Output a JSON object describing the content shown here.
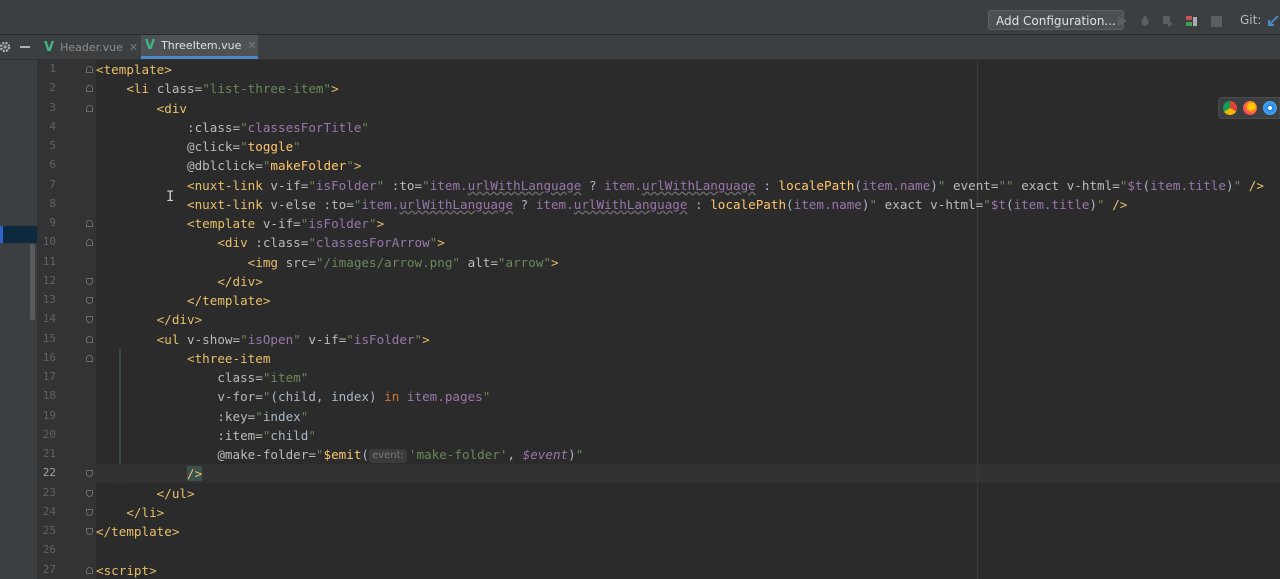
{
  "toolbar": {
    "add_configuration": "Add Configuration...",
    "git_label": "Git:"
  },
  "tabs": [
    {
      "label": "Header.vue",
      "active": false
    },
    {
      "label": "ThreeItem.vue",
      "active": true
    }
  ],
  "editor": {
    "current_line": 22,
    "line_numbers": [
      "1",
      "2",
      "3",
      "4",
      "5",
      "6",
      "7",
      "8",
      "9",
      "10",
      "11",
      "12",
      "13",
      "14",
      "15",
      "16",
      "17",
      "18",
      "19",
      "20",
      "21",
      "22",
      "23",
      "24",
      "25",
      "26",
      "27"
    ],
    "lines": [
      [
        [
          "t-tag",
          "<template>"
        ]
      ],
      [
        [
          "t-pun",
          "    "
        ],
        [
          "t-tag",
          "<li "
        ],
        [
          "t-attr",
          "class="
        ],
        [
          "t-str",
          "\"list-three-item\""
        ],
        [
          "t-tag",
          ">"
        ]
      ],
      [
        [
          "t-pun",
          "        "
        ],
        [
          "t-tag",
          "<div"
        ]
      ],
      [
        [
          "t-pun",
          "            "
        ],
        [
          "t-attr",
          ":class="
        ],
        [
          "t-str",
          "\""
        ],
        [
          "t-ident",
          "classesForTitle"
        ],
        [
          "t-str",
          "\""
        ]
      ],
      [
        [
          "t-pun",
          "            "
        ],
        [
          "t-attr",
          "@click="
        ],
        [
          "t-str",
          "\""
        ],
        [
          "t-fn",
          "toggle"
        ],
        [
          "t-str",
          "\""
        ]
      ],
      [
        [
          "t-pun",
          "            "
        ],
        [
          "t-attr",
          "@dblclick="
        ],
        [
          "t-str",
          "\""
        ],
        [
          "t-fn",
          "makeFolder"
        ],
        [
          "t-str",
          "\""
        ],
        [
          "t-tag",
          ">"
        ]
      ],
      [
        [
          "t-pun",
          "            "
        ],
        [
          "t-tag",
          "<nuxt-link "
        ],
        [
          "t-attr",
          "v-if="
        ],
        [
          "t-str",
          "\""
        ],
        [
          "t-ident",
          "isFolder"
        ],
        [
          "t-str",
          "\" "
        ],
        [
          "t-attr",
          ":to="
        ],
        [
          "t-str",
          "\""
        ],
        [
          "t-ident",
          "item."
        ],
        [
          "t-ident t-wavy",
          "urlWithLanguage"
        ],
        [
          "t-pun",
          " ? "
        ],
        [
          "t-ident",
          "item."
        ],
        [
          "t-ident t-wavy",
          "urlWithLanguage"
        ],
        [
          "t-pun",
          " : "
        ],
        [
          "t-fn",
          "localePath"
        ],
        [
          "t-pun",
          "("
        ],
        [
          "t-ident",
          "item.name"
        ],
        [
          "t-pun",
          ")"
        ],
        [
          "t-str",
          "\" "
        ],
        [
          "t-attr",
          "event="
        ],
        [
          "t-str",
          "\"\" "
        ],
        [
          "t-attr",
          "exact v-html="
        ],
        [
          "t-str",
          "\""
        ],
        [
          "t-ident",
          "$t"
        ],
        [
          "t-pun",
          "("
        ],
        [
          "t-ident",
          "item.title"
        ],
        [
          "t-pun",
          ")"
        ],
        [
          "t-str",
          "\" "
        ],
        [
          "t-tag",
          "/>"
        ]
      ],
      [
        [
          "t-pun",
          "            "
        ],
        [
          "t-tag",
          "<nuxt-link "
        ],
        [
          "t-attr",
          "v-else :to="
        ],
        [
          "t-str",
          "\""
        ],
        [
          "t-ident",
          "item."
        ],
        [
          "t-ident t-wavy",
          "urlWithLanguage"
        ],
        [
          "t-pun",
          " ? "
        ],
        [
          "t-ident",
          "item."
        ],
        [
          "t-ident t-wavy",
          "urlWithLanguage"
        ],
        [
          "t-pun",
          " : "
        ],
        [
          "t-fn",
          "localePath"
        ],
        [
          "t-pun",
          "("
        ],
        [
          "t-ident",
          "item.name"
        ],
        [
          "t-pun",
          ")"
        ],
        [
          "t-str",
          "\" "
        ],
        [
          "t-attr",
          "exact v-html="
        ],
        [
          "t-str",
          "\""
        ],
        [
          "t-ident",
          "$t"
        ],
        [
          "t-pun",
          "("
        ],
        [
          "t-ident",
          "item.title"
        ],
        [
          "t-pun",
          ")"
        ],
        [
          "t-str",
          "\" "
        ],
        [
          "t-tag",
          "/>"
        ]
      ],
      [
        [
          "t-pun",
          "            "
        ],
        [
          "t-tag",
          "<template "
        ],
        [
          "t-attr",
          "v-if="
        ],
        [
          "t-str",
          "\""
        ],
        [
          "t-ident",
          "isFolder"
        ],
        [
          "t-str",
          "\""
        ],
        [
          "t-tag",
          ">"
        ]
      ],
      [
        [
          "t-pun",
          "                "
        ],
        [
          "t-tag",
          "<div "
        ],
        [
          "t-attr",
          ":class="
        ],
        [
          "t-str",
          "\""
        ],
        [
          "t-ident",
          "classesForArrow"
        ],
        [
          "t-str",
          "\""
        ],
        [
          "t-tag",
          ">"
        ]
      ],
      [
        [
          "t-pun",
          "                    "
        ],
        [
          "t-tag",
          "<img "
        ],
        [
          "t-attr",
          "src="
        ],
        [
          "t-str",
          "\"/images/arrow.png\" "
        ],
        [
          "t-attr",
          "alt="
        ],
        [
          "t-str",
          "\"arrow\""
        ],
        [
          "t-tag",
          ">"
        ]
      ],
      [
        [
          "t-pun",
          "                "
        ],
        [
          "t-tag",
          "</div>"
        ]
      ],
      [
        [
          "t-pun",
          "            "
        ],
        [
          "t-tag",
          "</template>"
        ]
      ],
      [
        [
          "t-pun",
          "        "
        ],
        [
          "t-tag",
          "</div>"
        ]
      ],
      [
        [
          "t-pun",
          "        "
        ],
        [
          "t-tag",
          "<ul "
        ],
        [
          "t-attr",
          "v-show="
        ],
        [
          "t-str",
          "\""
        ],
        [
          "t-ident",
          "isOpen"
        ],
        [
          "t-str",
          "\" "
        ],
        [
          "t-attr",
          "v-if="
        ],
        [
          "t-str",
          "\""
        ],
        [
          "t-ident",
          "isFolder"
        ],
        [
          "t-str",
          "\""
        ],
        [
          "t-tag",
          ">"
        ]
      ],
      [
        [
          "t-pun",
          "            "
        ],
        [
          "t-tag",
          "<three-item"
        ]
      ],
      [
        [
          "t-pun",
          "                "
        ],
        [
          "t-attr",
          "class="
        ],
        [
          "t-str",
          "\"item\""
        ]
      ],
      [
        [
          "t-pun",
          "                "
        ],
        [
          "t-attr",
          "v-for="
        ],
        [
          "t-str",
          "\""
        ],
        [
          "t-pun",
          "(child, index) "
        ],
        [
          "t-kw",
          "in "
        ],
        [
          "t-ident",
          "item.pages"
        ],
        [
          "t-str",
          "\""
        ]
      ],
      [
        [
          "t-pun",
          "                "
        ],
        [
          "t-attr",
          ":key="
        ],
        [
          "t-str",
          "\""
        ],
        [
          "t-pun",
          "index"
        ],
        [
          "t-str",
          "\""
        ]
      ],
      [
        [
          "t-pun",
          "                "
        ],
        [
          "t-attr",
          ":item="
        ],
        [
          "t-str",
          "\""
        ],
        [
          "t-pun",
          "child"
        ],
        [
          "t-str",
          "\""
        ]
      ],
      [
        [
          "t-pun",
          "                "
        ],
        [
          "t-attr",
          "@make-folder="
        ],
        [
          "t-str",
          "\""
        ],
        [
          "t-fn",
          "$emit"
        ],
        [
          "t-pun",
          "("
        ],
        [
          "hint",
          "event:"
        ],
        [
          "t-emitstr",
          "'make-folder'"
        ],
        [
          "t-pun",
          ", "
        ],
        [
          "t-emitvar",
          "$event"
        ],
        [
          "t-pun",
          ")"
        ],
        [
          "t-str",
          "\""
        ]
      ],
      [
        [
          "t-pun",
          "            "
        ],
        [
          "t-tag caret-bg",
          "/>"
        ]
      ],
      [
        [
          "t-pun",
          "        "
        ],
        [
          "t-tag",
          "</ul>"
        ]
      ],
      [
        [
          "t-pun",
          "    "
        ],
        [
          "t-tag",
          "</li>"
        ]
      ],
      [
        [
          "t-tag",
          "</template>"
        ]
      ],
      [
        [
          "t-pun",
          ""
        ]
      ],
      [
        [
          "t-tag",
          "<script>"
        ]
      ]
    ]
  },
  "colors": {
    "vue_green": "#41b883",
    "tab_underline": "#4a88c7",
    "selection_blue": "#2f65ca"
  },
  "icons": [
    "settings-gear-icon",
    "minimize-icon",
    "run-icon",
    "debug-icon",
    "coverage-icon",
    "profile-icon",
    "stop-icon",
    "git-update-icon",
    "chrome-icon",
    "firefox-icon",
    "safari-icon",
    "vue-file-icon",
    "close-tab-icon",
    "text-cursor-icon"
  ]
}
